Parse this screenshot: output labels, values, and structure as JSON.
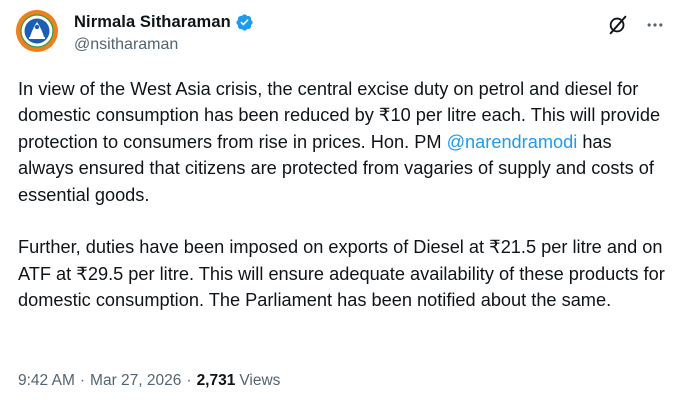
{
  "author": {
    "name": "Nirmala Sitharaman",
    "handle": "@nsitharaman"
  },
  "icons": {
    "avatar": "emblem-avatar",
    "verified": "verified-badge-icon",
    "grok": "grok-icon",
    "more": "more-options-icon"
  },
  "colors": {
    "accent": "#1d9bf0",
    "avatar_bg": "#f07f1e",
    "secondary_text": "#536471",
    "verified": "#1d9bf0"
  },
  "tweet": {
    "p1_part1": "In view of the West Asia crisis, the central excise duty on petrol and diesel for domestic consumption has been reduced by ₹10 per litre each. This will provide protection to consumers from rise in prices. Hon. PM ",
    "mention": "@narendramodi",
    "p1_part2": " has always ensured that citizens are protected from vagaries of supply and costs of essential goods.",
    "p2": "Further, duties have been imposed on exports of Diesel at ₹21.5 per litre and on ATF at ₹29.5 per litre. This will ensure adequate availability of these products for domestic consumption. The Parliament has been notified about the same."
  },
  "meta": {
    "time": "9:42 AM",
    "date": "Mar 27, 2026",
    "views_count": "2,731",
    "views_label": "Views",
    "separator": "·"
  }
}
